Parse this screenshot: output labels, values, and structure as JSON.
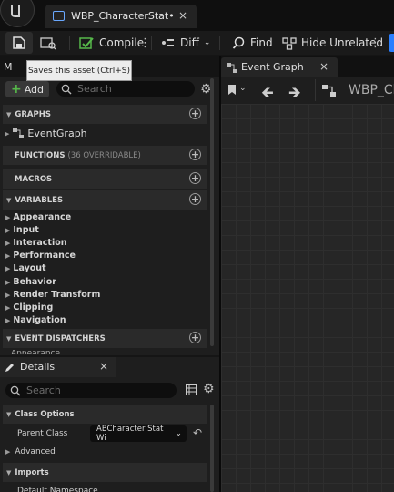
{
  "titlebar": {
    "doc_tab": "WBP_CharacterStat•",
    "close": "×"
  },
  "toolbar": {
    "compile": "Compile",
    "diff": "Diff",
    "find": "Find",
    "hide_unrelated": "Hide Unrelated"
  },
  "tooltip": "Saves this asset (Ctrl+S)",
  "my_blueprint": {
    "tab_label": "M",
    "add_label": "Add",
    "search_placeholder": "Search",
    "sections": {
      "graphs": "GRAPHS",
      "event_graph": "EventGraph",
      "functions": "FUNCTIONS",
      "functions_count": "(36 OVERRIDABLE)",
      "macros": "MACROS",
      "variables": "VARIABLES",
      "event_dispatchers": "EVENT DISPATCHERS"
    },
    "variable_categories": [
      "Appearance",
      "Input",
      "Interaction",
      "Performance",
      "Layout",
      "Behavior",
      "Render Transform",
      "Clipping",
      "Navigation"
    ],
    "partial_item": "Appearance"
  },
  "graph_panel": {
    "tab_label": "Event Graph",
    "close": "×",
    "breadcrumb": "WBP_Ch"
  },
  "details": {
    "tab_label": "Details",
    "close": "×",
    "search_placeholder": "Search",
    "class_options": "Class Options",
    "parent_class_label": "Parent Class",
    "parent_class_value": "ABCharacter Stat Wi",
    "advanced": "Advanced",
    "imports": "Imports",
    "default_namespace": "Default Namespace"
  },
  "colors": {
    "accent": "#2a7fff",
    "green": "#56b84a"
  }
}
